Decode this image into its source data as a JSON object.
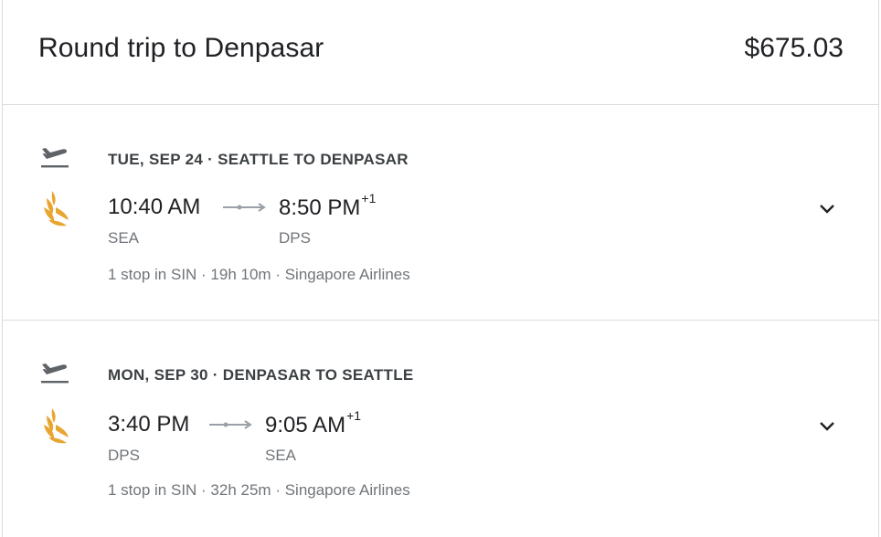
{
  "header": {
    "title": "Round trip to Denpasar",
    "price": "$675.03"
  },
  "legs": [
    {
      "direction_icon": "takeoff-icon",
      "date_route": "TUE, SEP 24 · SEATTLE TO DENPASAR",
      "airline_logo": "singapore-airlines-logo",
      "depart_time": "10:40 AM",
      "arrive_time": "8:50 PM",
      "day_offset": "+1",
      "from_code": "SEA",
      "to_code": "DPS",
      "details": "1 stop in SIN · 19h 10m · Singapore Airlines",
      "expand_icon": "chevron-down-icon"
    },
    {
      "direction_icon": "takeoff-icon",
      "date_route": "MON, SEP 30 · DENPASAR TO SEATTLE",
      "airline_logo": "singapore-airlines-logo",
      "depart_time": "3:40 PM",
      "arrive_time": "9:05 AM",
      "day_offset": "+1",
      "from_code": "DPS",
      "to_code": "SEA",
      "details": "1 stop in SIN · 32h 25m · Singapore Airlines",
      "expand_icon": "chevron-down-icon"
    }
  ],
  "colors": {
    "logo": "#e8a530",
    "divider": "#dadce0",
    "primary_text": "#202124",
    "secondary_text": "#70757a"
  }
}
